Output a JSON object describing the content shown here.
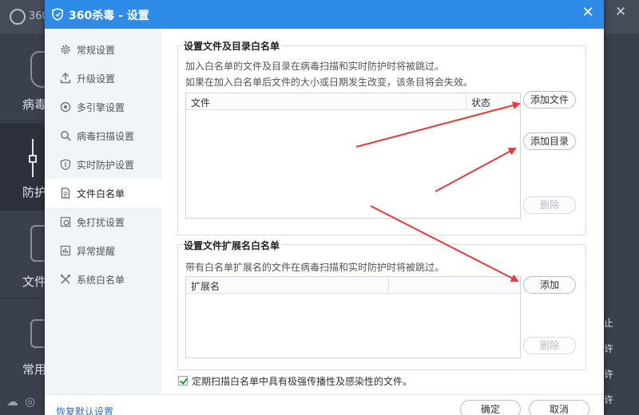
{
  "background": {
    "app_title": "360",
    "sidebar": [
      {
        "label": "病毒"
      },
      {
        "label": "防护"
      },
      {
        "label": "文件"
      },
      {
        "label": "常用"
      }
    ],
    "right_texts": [
      "止",
      "许",
      "许",
      "许"
    ]
  },
  "dialog": {
    "title": "360杀毒 - 设置",
    "nav": [
      {
        "label": "常规设置",
        "icon": "gear-icon"
      },
      {
        "label": "升级设置",
        "icon": "upload-icon"
      },
      {
        "label": "多引擎设置",
        "icon": "engine-icon"
      },
      {
        "label": "病毒扫描设置",
        "icon": "search-icon"
      },
      {
        "label": "实时防护设置",
        "icon": "shield-icon"
      },
      {
        "label": "文件白名单",
        "icon": "document-icon"
      },
      {
        "label": "免打扰设置",
        "icon": "no-disturb-icon"
      },
      {
        "label": "异常提醒",
        "icon": "bar-chart-icon"
      },
      {
        "label": "系统白名单",
        "icon": "tools-icon"
      }
    ],
    "active_nav": "文件白名单",
    "file_group": {
      "title": "设置文件及目录白名单",
      "desc_line1": "加入白名单的文件及目录在病毒扫描和实时防护时将被跳过。",
      "desc_line2": "如果在加入白名单后文件的大小或日期发生改变，该条目将会失效。",
      "col_file": "文件",
      "col_status": "状态",
      "btn_add_file": "添加文件",
      "btn_add_dir": "添加目录",
      "btn_delete": "删除"
    },
    "ext_group": {
      "title": "设置文件扩展名白名单",
      "desc": "带有白名单扩展名的文件在病毒扫描和实时防护时将被跳过。",
      "col_ext": "扩展名",
      "btn_add": "添加",
      "btn_delete": "删除"
    },
    "checkbox_label": "定期扫描白名单中具有极强传播性及感染性的文件。",
    "checkbox_checked": true,
    "restore_link": "恢复默认设置",
    "btn_ok": "确定",
    "btn_cancel": "取消",
    "colors": {
      "titlebar": "#2e8be8",
      "arrow": "#e83a3a",
      "nav_bg": "#f0f5fa"
    }
  }
}
